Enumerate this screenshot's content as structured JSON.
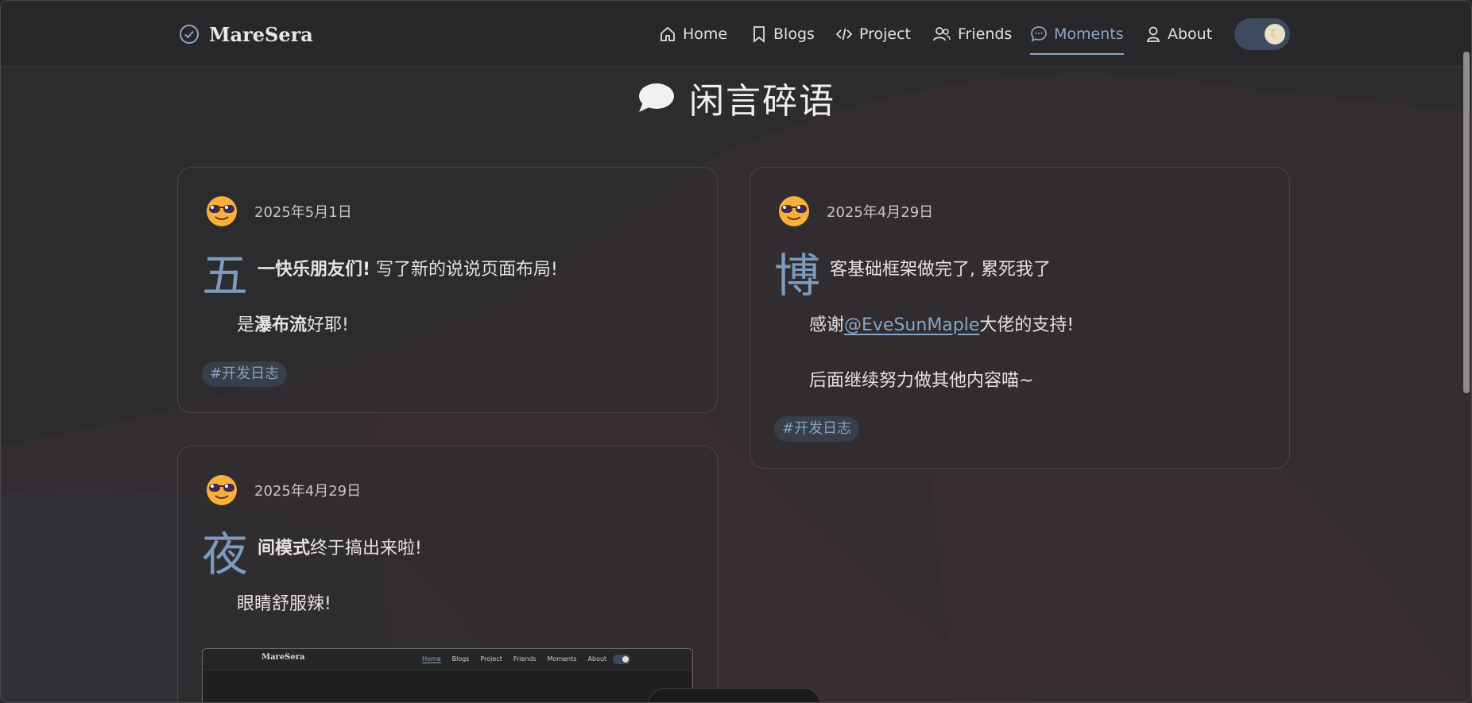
{
  "nav": {
    "brand": "MareSera",
    "items": [
      {
        "label": "Home",
        "icon": "home-icon"
      },
      {
        "label": "Blogs",
        "icon": "bookmark-icon"
      },
      {
        "label": "Project",
        "icon": "code-icon"
      },
      {
        "label": "Friends",
        "icon": "users-icon"
      },
      {
        "label": "Moments",
        "icon": "chat-bubble-icon",
        "active": true
      },
      {
        "label": "About",
        "icon": "user-icon"
      }
    ],
    "theme_toggle": "dark"
  },
  "page": {
    "title": "闲言碎语",
    "title_icon": "speech-bubble-icon"
  },
  "moments": [
    {
      "date": "2025年5月1日",
      "dropcap": "五",
      "line1_bold": "一快乐朋友们!",
      "line1_rest": " 写了新的说说页面布局!",
      "line2_pre": "是",
      "line2_bold": "瀑布流",
      "line2_post": "好耶!",
      "tag": "#开发日志"
    },
    {
      "date": "2025年4月29日",
      "dropcap": "博",
      "line1": "客基础框架做完了, 累死我了",
      "line2_pre": "感谢",
      "line2_link": "@EveSunMaple",
      "line2_post": "大佬的支持!",
      "line3": "后面继续努力做其他内容喵~",
      "tag": "#开发日志"
    },
    {
      "date": "2025年4月29日",
      "dropcap": "夜",
      "line1_bold": "间模式",
      "line1_rest": "终于搞出来啦!",
      "line2": "眼睛舒服辣!",
      "thumb": {
        "brand": "MareSera",
        "menu": [
          "Home",
          "Blogs",
          "Project",
          "Friends",
          "Moments",
          "About"
        ]
      }
    }
  ],
  "colors": {
    "background": "#2c2b2d",
    "accent": "#8aa6c7",
    "dropcap": "#7c9bbd",
    "tag_bg": "#383e4a"
  }
}
